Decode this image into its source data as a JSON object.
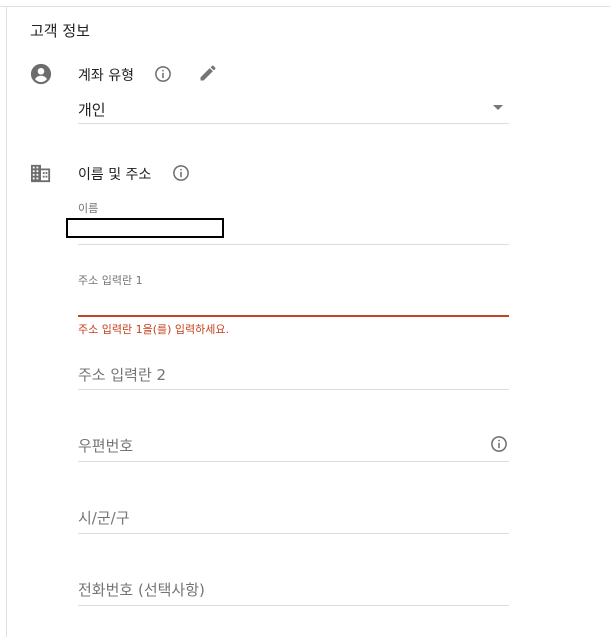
{
  "section": {
    "title": "고객 정보"
  },
  "account_type": {
    "label": "계좌 유형",
    "selected": "개인",
    "icons": [
      "person-circle-icon",
      "info-icon",
      "pencil-icon"
    ]
  },
  "name_address": {
    "label": "이름 및 주소",
    "icons": [
      "building-icon",
      "info-icon"
    ],
    "fields": {
      "name": {
        "label": "이름",
        "value": ""
      },
      "address1": {
        "label": "주소 입력란 1",
        "value": "",
        "error": "주소 입력란 1을(를) 입력하세요."
      },
      "address2": {
        "placeholder": "주소 입력란 2"
      },
      "postal_code": {
        "placeholder": "우편번호"
      },
      "city": {
        "placeholder": "시/군/구"
      },
      "phone": {
        "placeholder": "전화번호 (선택사항)"
      }
    }
  },
  "colors": {
    "error": "#c5411f",
    "icon": "#757575",
    "divider": "#dcdcdc"
  }
}
